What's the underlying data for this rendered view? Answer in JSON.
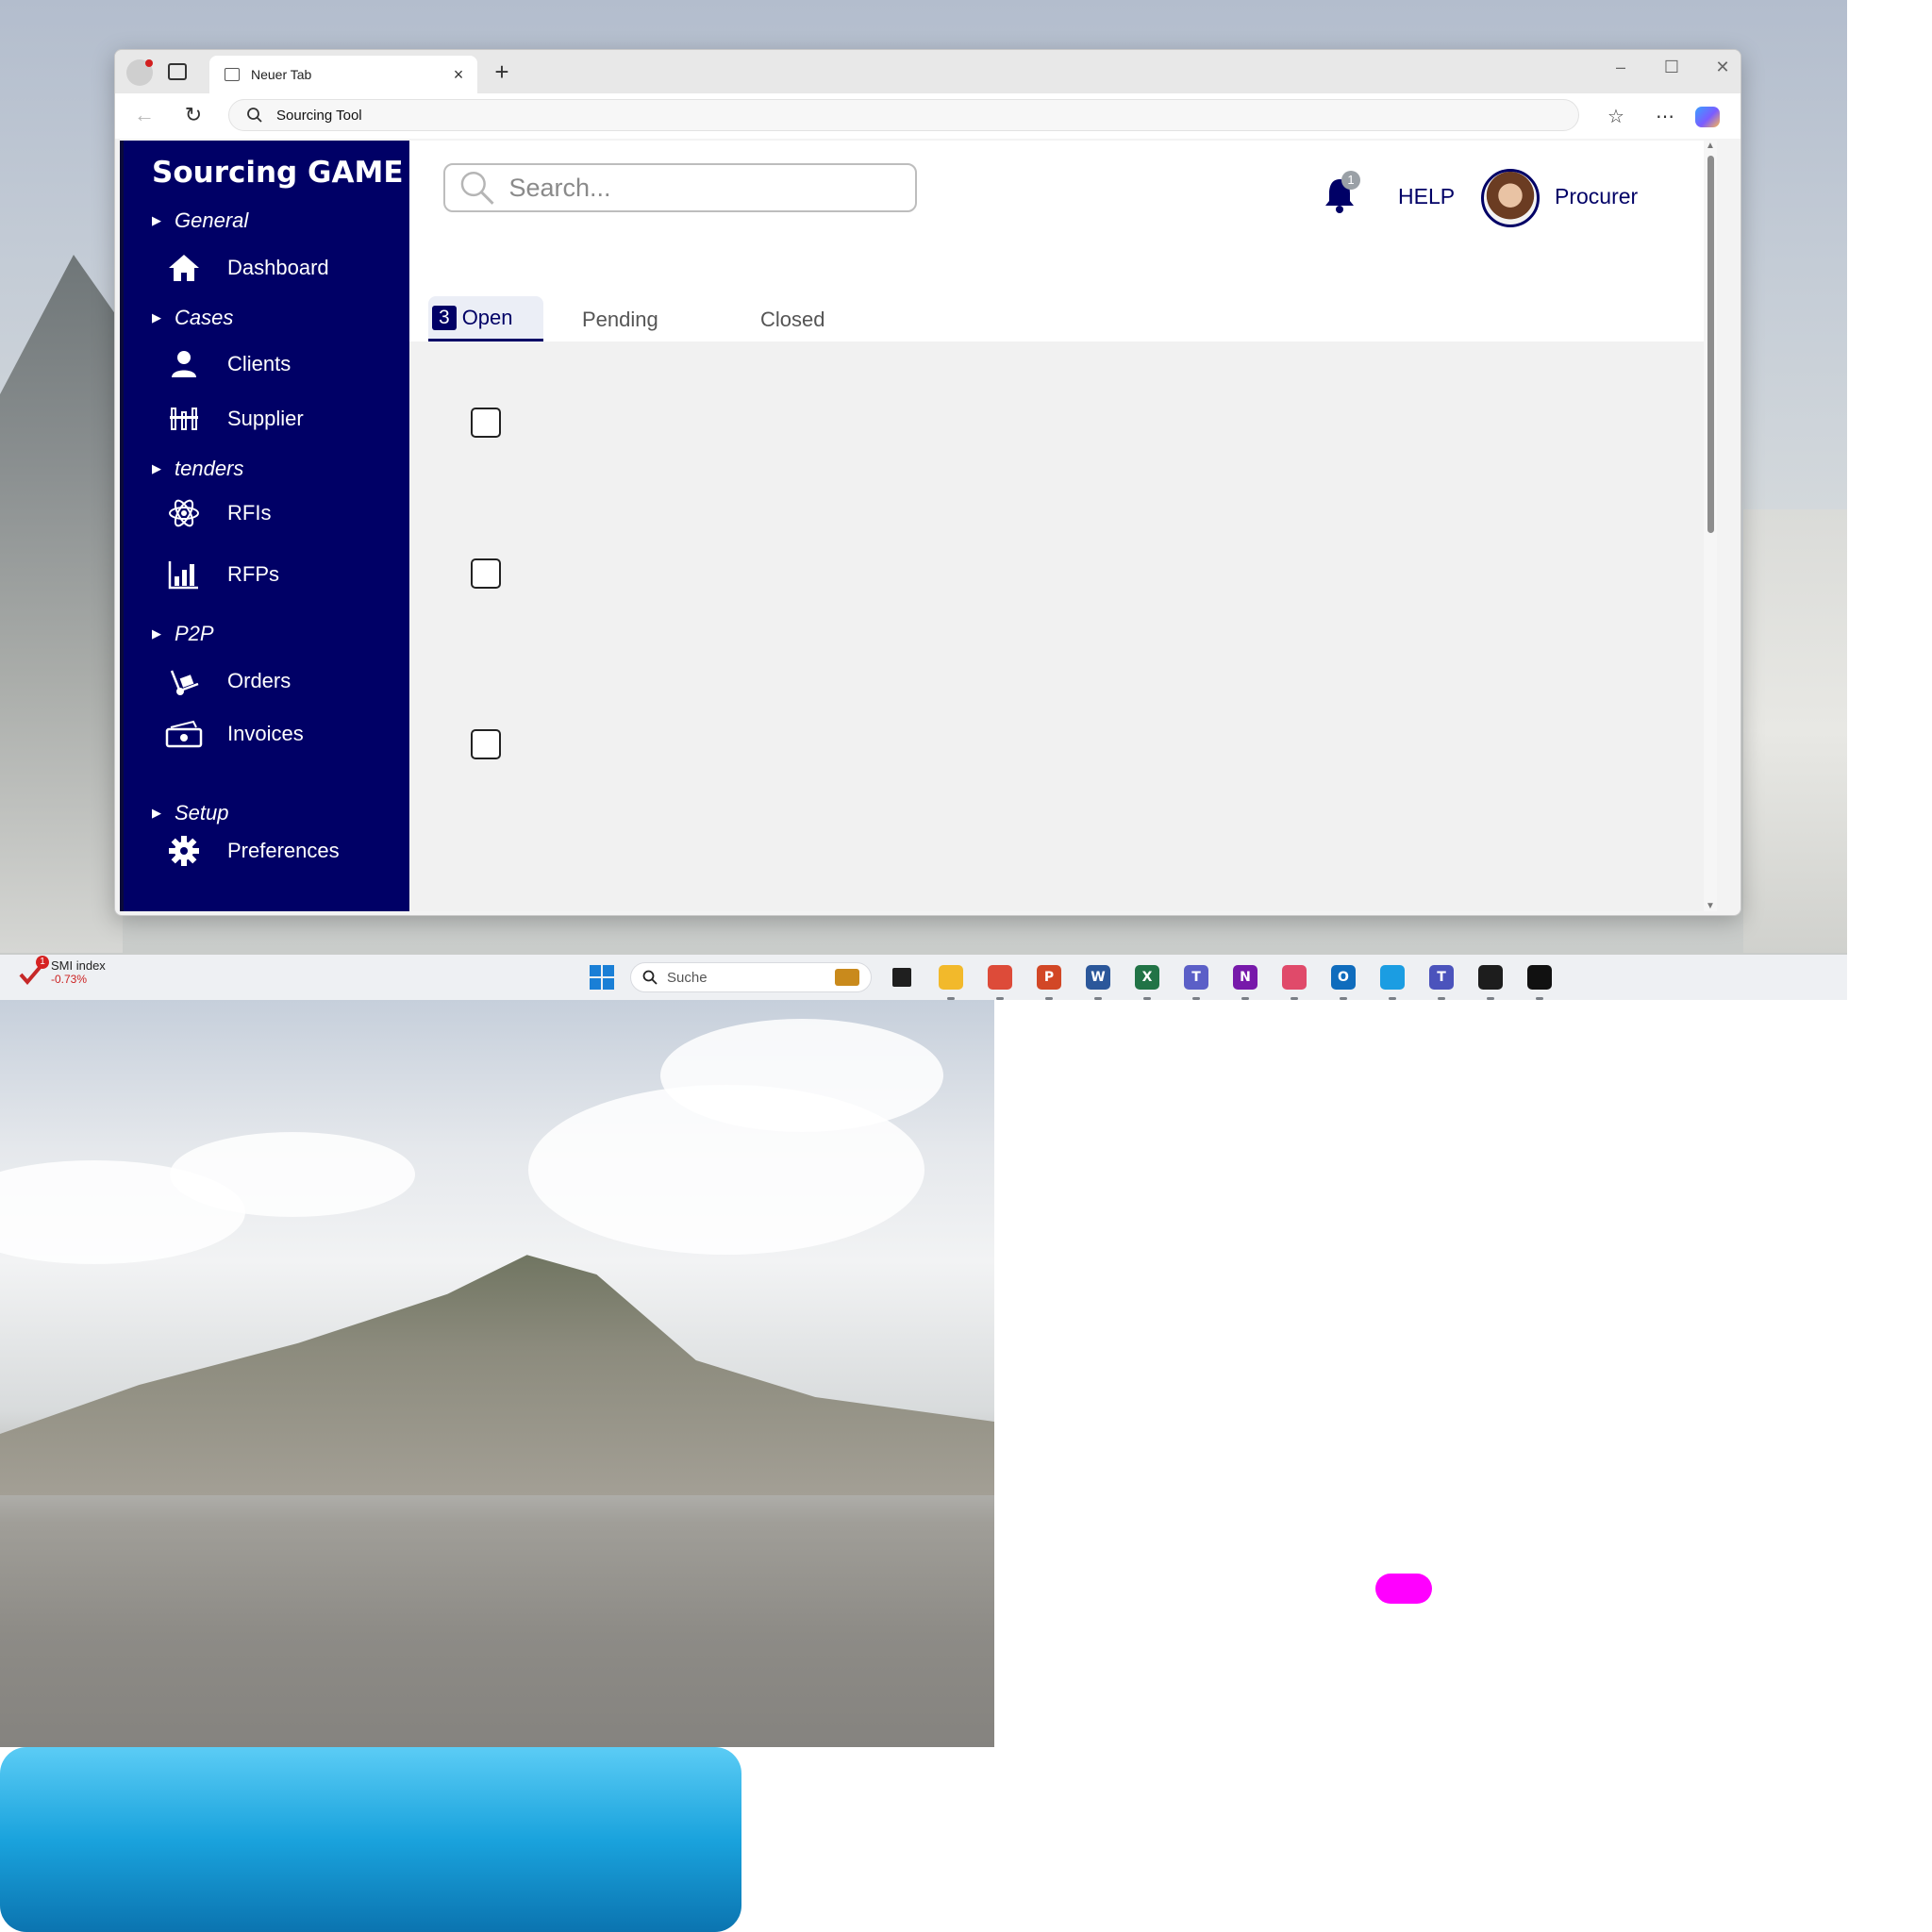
{
  "browser": {
    "tab_title": "Neuer Tab",
    "new_tab_symbol": "+",
    "close_tab_symbol": "×",
    "address": "Sourcing Tool",
    "window_controls": [
      "–",
      "☐",
      "✕"
    ]
  },
  "app": {
    "brand": "Sourcing GAME",
    "sidebar": {
      "sections": [
        {
          "label": "General",
          "items": [
            {
              "label": "Dashboard",
              "icon": "home-icon"
            }
          ]
        },
        {
          "label": "Cases",
          "items": [
            {
              "label": "Clients",
              "icon": "person-icon"
            },
            {
              "label": "Supplier",
              "icon": "supplier-icon"
            }
          ]
        },
        {
          "label": "tenders",
          "items": [
            {
              "label": "RFIs",
              "icon": "atom-icon"
            },
            {
              "label": "RFPs",
              "icon": "bar-chart-icon"
            }
          ]
        },
        {
          "label": "P2P",
          "items": [
            {
              "label": "Orders",
              "icon": "dolly-icon"
            },
            {
              "label": "Invoices",
              "icon": "money-icon"
            }
          ]
        },
        {
          "label": "Setup",
          "items": [
            {
              "label": "Preferences",
              "icon": "gear-icon"
            }
          ]
        }
      ]
    },
    "header": {
      "search_placeholder": "Search...",
      "notification_count": "1",
      "help_label": "HELP",
      "user_role": "Procurer"
    },
    "tabs": {
      "open_count": "3",
      "open_label": "Open",
      "pending_label": "Pending",
      "closed_label": "Closed"
    },
    "rows": [
      {
        "checked": false
      },
      {
        "checked": false
      },
      {
        "checked": false
      }
    ]
  },
  "taskbar": {
    "widget_badge": "1",
    "widget_title": "SMI index",
    "widget_delta": "-0.73%",
    "search_label": "Suche",
    "apps": [
      {
        "icon": "file-explorer-icon",
        "letter": "",
        "color": "#f2b92b"
      },
      {
        "icon": "chrome-icon",
        "letter": "",
        "color": "#dd4b39"
      },
      {
        "icon": "powerpoint-icon",
        "letter": "P",
        "color": "#d24726"
      },
      {
        "icon": "word-icon",
        "letter": "W",
        "color": "#2b579a"
      },
      {
        "icon": "excel-icon",
        "letter": "X",
        "color": "#217346"
      },
      {
        "icon": "teams-icon",
        "letter": "T",
        "color": "#5b5fc7"
      },
      {
        "icon": "onenote-icon",
        "letter": "N",
        "color": "#7719aa"
      },
      {
        "icon": "snipping-tool-icon",
        "letter": "",
        "color": "#e04a6a"
      },
      {
        "icon": "outlook-icon",
        "letter": "O",
        "color": "#0f6cbd"
      },
      {
        "icon": "edge-icon",
        "letter": "",
        "color": "#1b9de2"
      },
      {
        "icon": "teams-work-icon",
        "letter": "T",
        "color": "#4b53bc"
      },
      {
        "icon": "webex-icon",
        "letter": "",
        "color": "#1d1d1d"
      },
      {
        "icon": "app-diamond-icon",
        "letter": "",
        "color": "#111111"
      }
    ]
  },
  "colors": {
    "sidebar": "#000066",
    "accent": "#000066",
    "list_background": "#f1f1f1",
    "blue_panel": "#1aa3dd",
    "magenta_marker": "#ff00ff"
  }
}
